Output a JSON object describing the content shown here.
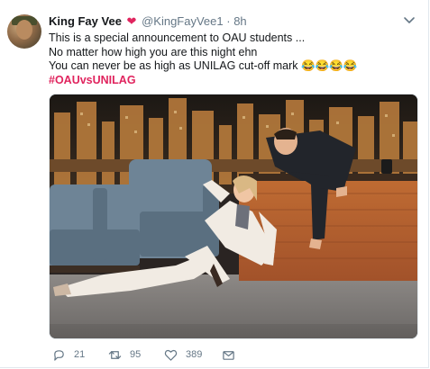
{
  "tweet": {
    "author_name": "King Fay Vee",
    "heart": "❤",
    "handle": "@KingFayVee1",
    "separator": "·",
    "time": "8h",
    "lines": [
      "This is a special announcement to OAU students ...",
      "No matter how high you are this night ehn",
      "You can never be as high as UNILAG cut-off mark 😂😂😂😂"
    ],
    "hashtag": "#OAUvsUNILAG",
    "hashtag_color": "#e0245e",
    "media": {
      "icon": "photo",
      "content": "Woman in white suit laughing on the floor beside a talk-show set, man in dark suit leaning over the wooden desk"
    },
    "actions": {
      "reply_count": "21",
      "retweet_count": "95",
      "like_count": "389"
    },
    "icons": [
      "avatar",
      "heart-emoji",
      "chevron-down-icon",
      "reply-icon",
      "retweet-icon",
      "like-icon",
      "message-icon"
    ]
  }
}
